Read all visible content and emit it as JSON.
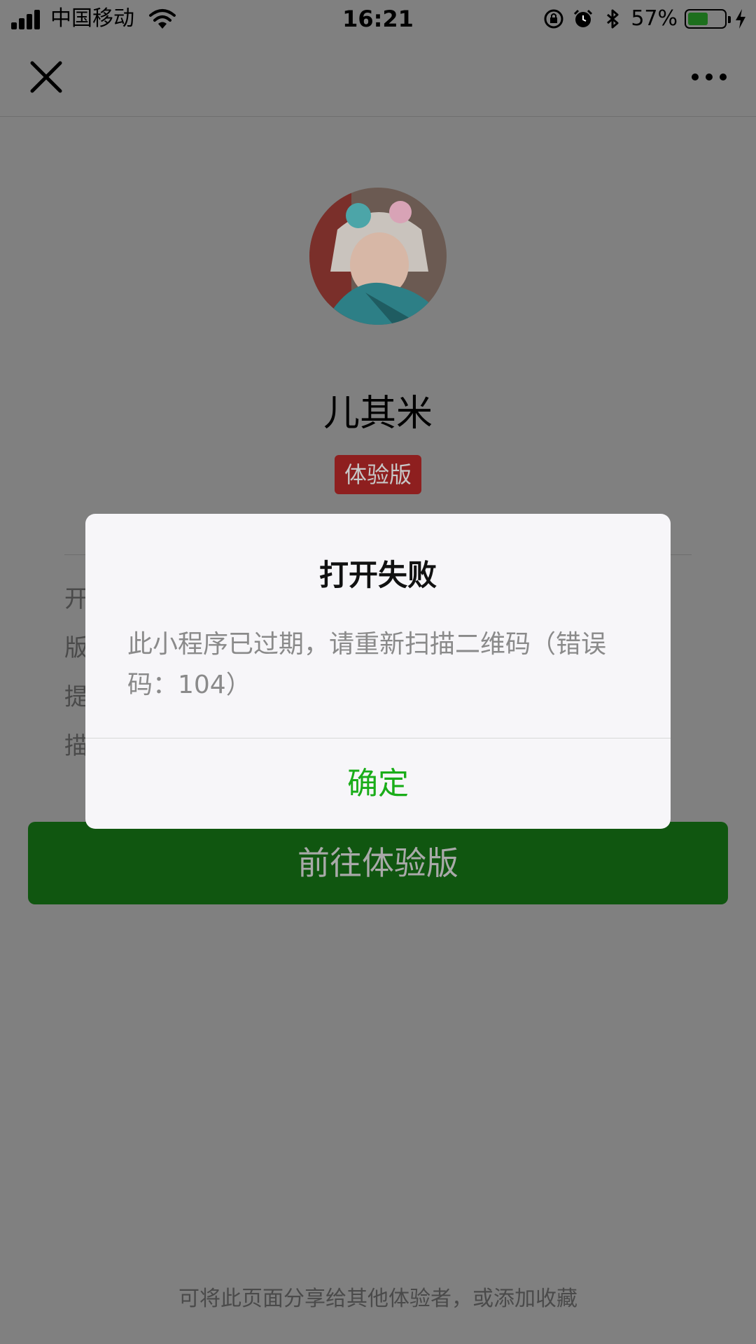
{
  "status_bar": {
    "carrier": "中国移动",
    "time": "16:21",
    "battery_percent_text": "57%",
    "battery_level": 0.57,
    "icons": [
      "signal-icon",
      "wifi-icon",
      "orientation-lock-icon",
      "alarm-icon",
      "bluetooth-icon",
      "battery-icon",
      "charging-icon"
    ]
  },
  "nav": {
    "close_icon": "close-icon",
    "more_icon": "more-icon"
  },
  "app": {
    "name": "儿其米",
    "badge": "体验版"
  },
  "info_lines": [
    "开",
    "版",
    "提",
    "描"
  ],
  "primary_button": "前往体验版",
  "footer_hint": "可将此页面分享给其他体验者，或添加收藏",
  "dialog": {
    "title": "打开失败",
    "message": "此小程序已过期，请重新扫描二维码（错误码：104）",
    "confirm": "确定"
  },
  "colors": {
    "overlay_background": "#808080",
    "accent_green": "#1aad19",
    "badge_red": "#8e1f1f",
    "button_green": "#105610"
  }
}
